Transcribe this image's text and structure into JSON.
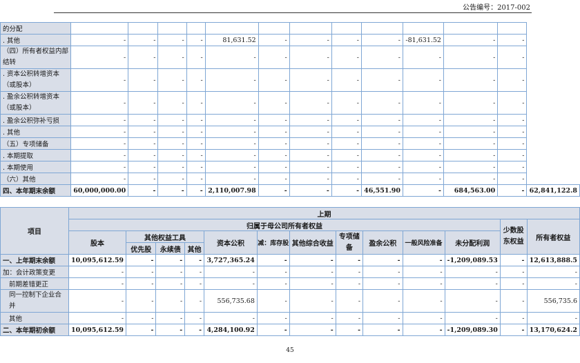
{
  "header": {
    "notice_no": "公告编号：2017-002"
  },
  "top_table": {
    "rows": [
      {
        "label": "的分配",
        "cells": [
          "",
          "",
          "",
          "",
          "",
          "",
          "",
          "",
          "",
          "",
          "",
          ""
        ]
      },
      {
        "label": ". 其他",
        "cells": [
          "-",
          "-",
          "-",
          "-",
          "81,631.52",
          "-",
          "-",
          "-",
          "-",
          "-81,631.52",
          "-",
          "-"
        ]
      },
      {
        "label": "（四）所有者权益内部结转",
        "cells": [
          "-",
          "-",
          "-",
          "-",
          "-",
          "-",
          "-",
          "-",
          "-",
          "-",
          "-",
          "-"
        ]
      },
      {
        "label": ". 资本公积转增资本（或股本）",
        "cells": [
          "-",
          "-",
          "-",
          "-",
          "-",
          "-",
          "-",
          "-",
          "-",
          "-",
          "-",
          "-"
        ]
      },
      {
        "label": ". 盈余公积转增资本（或股本）",
        "cells": [
          "-",
          "-",
          "-",
          "-",
          "-",
          "-",
          "-",
          "-",
          "-",
          "-",
          "-",
          "-"
        ]
      },
      {
        "label": ". 盈余公积弥补亏损",
        "cells": [
          "-",
          "-",
          "-",
          "-",
          "-",
          "-",
          "-",
          "-",
          "-",
          "-",
          "-",
          "-"
        ]
      },
      {
        "label": ". 其他",
        "cells": [
          "-",
          "-",
          "-",
          "-",
          "-",
          "-",
          "-",
          "-",
          "-",
          "-",
          "-",
          "-"
        ]
      },
      {
        "label": "（五）专项储备",
        "cells": [
          "-",
          "-",
          "-",
          "-",
          "-",
          "-",
          "-",
          "-",
          "-",
          "-",
          "-",
          "-"
        ]
      },
      {
        "label": ". 本期提取",
        "cells": [
          "-",
          "-",
          "-",
          "-",
          "-",
          "-",
          "-",
          "-",
          "-",
          "-",
          "-",
          "-"
        ]
      },
      {
        "label": ". 本期使用",
        "cells": [
          "-",
          "-",
          "-",
          "-",
          "-",
          "-",
          "-",
          "-",
          "-",
          "-",
          "-",
          "-"
        ]
      },
      {
        "label": "（六）其他",
        "cells": [
          "-",
          "-",
          "-",
          "-",
          "-",
          "-",
          "-",
          "-",
          "-",
          "-",
          "-",
          "-"
        ]
      },
      {
        "label": "四、本年期末余额",
        "cells": [
          "60,000,000.00",
          "-",
          "-",
          "-",
          "2,110,007.98",
          "-",
          "-",
          "-",
          "46,551.90",
          "-",
          "684,563.00",
          "-",
          "62,841,122.8"
        ]
      }
    ]
  },
  "bottom_table": {
    "header": {
      "item": "项目",
      "period": "上期",
      "group": "归属于母公司所有者权益",
      "share_capital": "股本",
      "other_equity": "其他权益工具",
      "preferred": "优先股",
      "perpetual": "永续债",
      "other": "其他",
      "capital_reserve": "资本公积",
      "treasury": "减：库存股",
      "oci": "其他综合收益",
      "special_reserve": "专项储备",
      "surplus_reserve": "盈余公积",
      "general_risk": "一般风险准备",
      "retained": "未分配利润",
      "minority": "少数股东权益",
      "total": "所有者权益"
    },
    "rows": [
      {
        "label": "一、上年期末余额",
        "cells": [
          "10,095,612.59",
          "-",
          "-",
          "-",
          "3,727,365.24",
          "-",
          "-",
          "-",
          "-",
          "-",
          "-1,209,089.53",
          "-",
          "12,613,888.5"
        ]
      },
      {
        "label": "加：会计政策变更",
        "cells": [
          "-",
          "-",
          "-",
          "-",
          "-",
          "-",
          "-",
          "-",
          "-",
          "-",
          "-",
          "-",
          "-"
        ]
      },
      {
        "label": "前期差错更正",
        "cells": [
          "-",
          "-",
          "-",
          "-",
          "-",
          "-",
          "-",
          "-",
          "-",
          "-",
          "-",
          "-",
          "-"
        ]
      },
      {
        "label": "同一控制下企业合并",
        "cells": [
          "-",
          "-",
          "-",
          "-",
          "556,735.68",
          "-",
          "-",
          "-",
          "-",
          "-",
          "-",
          "-",
          "556,735.6"
        ]
      },
      {
        "label": "其他",
        "cells": [
          "-",
          "-",
          "-",
          "-",
          "-",
          "-",
          "-",
          "-",
          "-",
          "-",
          "-",
          "-",
          "-"
        ]
      },
      {
        "label": "二、本年期初余额",
        "cells": [
          "10,095,612.59",
          "-",
          "-",
          "-",
          "4,284,100.92",
          "-",
          "-",
          "-",
          "-",
          "-",
          "-1,209,089.30",
          "-",
          "13,170,624.2"
        ]
      }
    ]
  },
  "footer": {
    "page_number": "45"
  }
}
